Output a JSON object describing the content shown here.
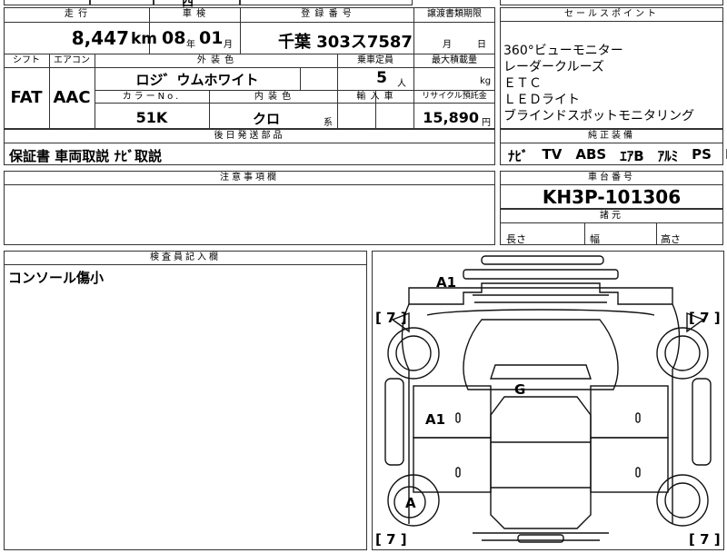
{
  "top_strip": {
    "partial_text_1": "西",
    "partial_text_2": ""
  },
  "vehicle": {
    "mileage_label": "走 行",
    "mileage_value": "8,447",
    "mileage_unit": "km",
    "inspection_label": "車 検",
    "inspection_year": "08",
    "inspection_year_unit": "年",
    "inspection_month": "01",
    "inspection_month_unit": "月",
    "registration_label": "登 録 番 号",
    "registration_value": "千葉 303ス7587",
    "transfer_label": "譲渡書類期限",
    "transfer_month_unit": "月",
    "transfer_day_unit": "日",
    "shift_label": "シフト",
    "shift_value": "FAT",
    "aircon_label": "エアコン",
    "aircon_value": "AAC",
    "exterior_color_label": "外 装 色",
    "exterior_color_value": "ロジ゛ウムホワイト",
    "capacity_label": "乗車定員",
    "capacity_value": "5",
    "capacity_unit": "人",
    "max_load_label": "最大積載量",
    "max_load_unit": "kg",
    "color_no_label": "カラーNo.",
    "color_no_value": "51K",
    "interior_color_label": "内 装 色",
    "interior_color_value": "クロ",
    "interior_color_unit": "系",
    "import_label": "輸 入 車",
    "recycle_label": "リサイクル預託金",
    "recycle_value": "15,890",
    "recycle_unit": "円"
  },
  "sales_points": {
    "title": "セールスポイント",
    "items": [
      "360°ビューモニター",
      "レーダークルーズ",
      "ＥＴＣ",
      "ＬＥＤライト",
      "ブラインドスポットモニタリング"
    ]
  },
  "later_parts": {
    "title": "後日発送部品",
    "value": "保証書 車両取説 ﾅﾋﾞ取説"
  },
  "genuine_equipment": {
    "title": "純正装備",
    "items": [
      "ﾅﾋﾞ",
      "TV",
      "ABS",
      "ｴｱB",
      "ｱﾙﾐ",
      "PS",
      "PW"
    ]
  },
  "notes": {
    "title": "注意事項欄",
    "value": ""
  },
  "chassis": {
    "title": "車台番号",
    "value": "KH3P-101306"
  },
  "dimensions": {
    "title": "諸元",
    "length_label": "長さ",
    "width_label": "幅",
    "height_label": "高さ"
  },
  "inspector": {
    "title": "検査員記入欄",
    "value": "コンソール傷小"
  },
  "diagram": {
    "marks": [
      {
        "label": "A1",
        "area": "front-bumper"
      },
      {
        "label": "A1",
        "area": "right-side-door"
      },
      {
        "label": "G",
        "area": "windshield"
      },
      {
        "label": "A",
        "area": "rear-left-wheel"
      }
    ],
    "tire_marks": [
      "[ 7 ]",
      "[ 7 ]",
      "[ 7 ]",
      "[ 7 ]"
    ]
  }
}
